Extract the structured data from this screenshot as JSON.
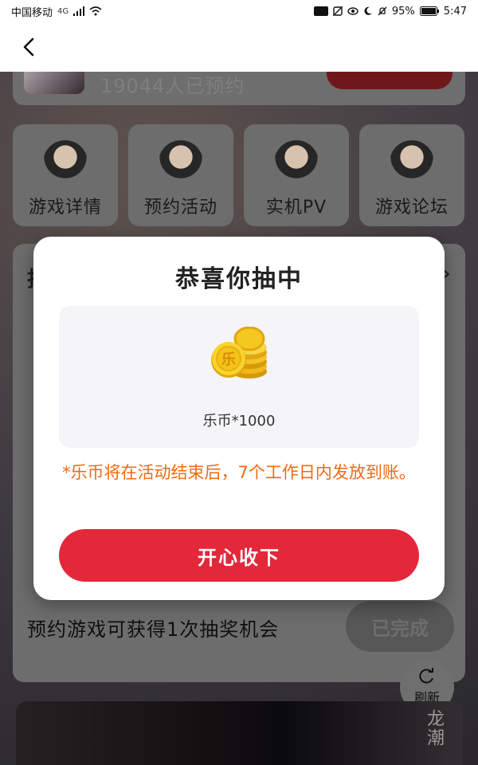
{
  "status_bar": {
    "carrier": "中国移动",
    "network": "4G",
    "battery": "95%",
    "time": "5:47"
  },
  "background": {
    "reserved_count": "19044人已预约",
    "tiles": [
      "游戏详情",
      "预约活动",
      "实机PV",
      "游戏论坛"
    ],
    "lottery_heading_peek": "抽",
    "task_text": "预约游戏可获得1次抽奖机会",
    "task_button": "已完成",
    "refresh_label": "刷新",
    "banner_title": "龙潮"
  },
  "modal": {
    "title": "恭喜你抽中",
    "prize": "乐币*1000",
    "coin_glyph": "乐",
    "notice": "*乐币将在活动结束后，7个工作日内发放到账。",
    "accept_button": "开心收下"
  },
  "colors": {
    "accent_red": "#e3283a",
    "notice_orange": "#f06a12"
  }
}
